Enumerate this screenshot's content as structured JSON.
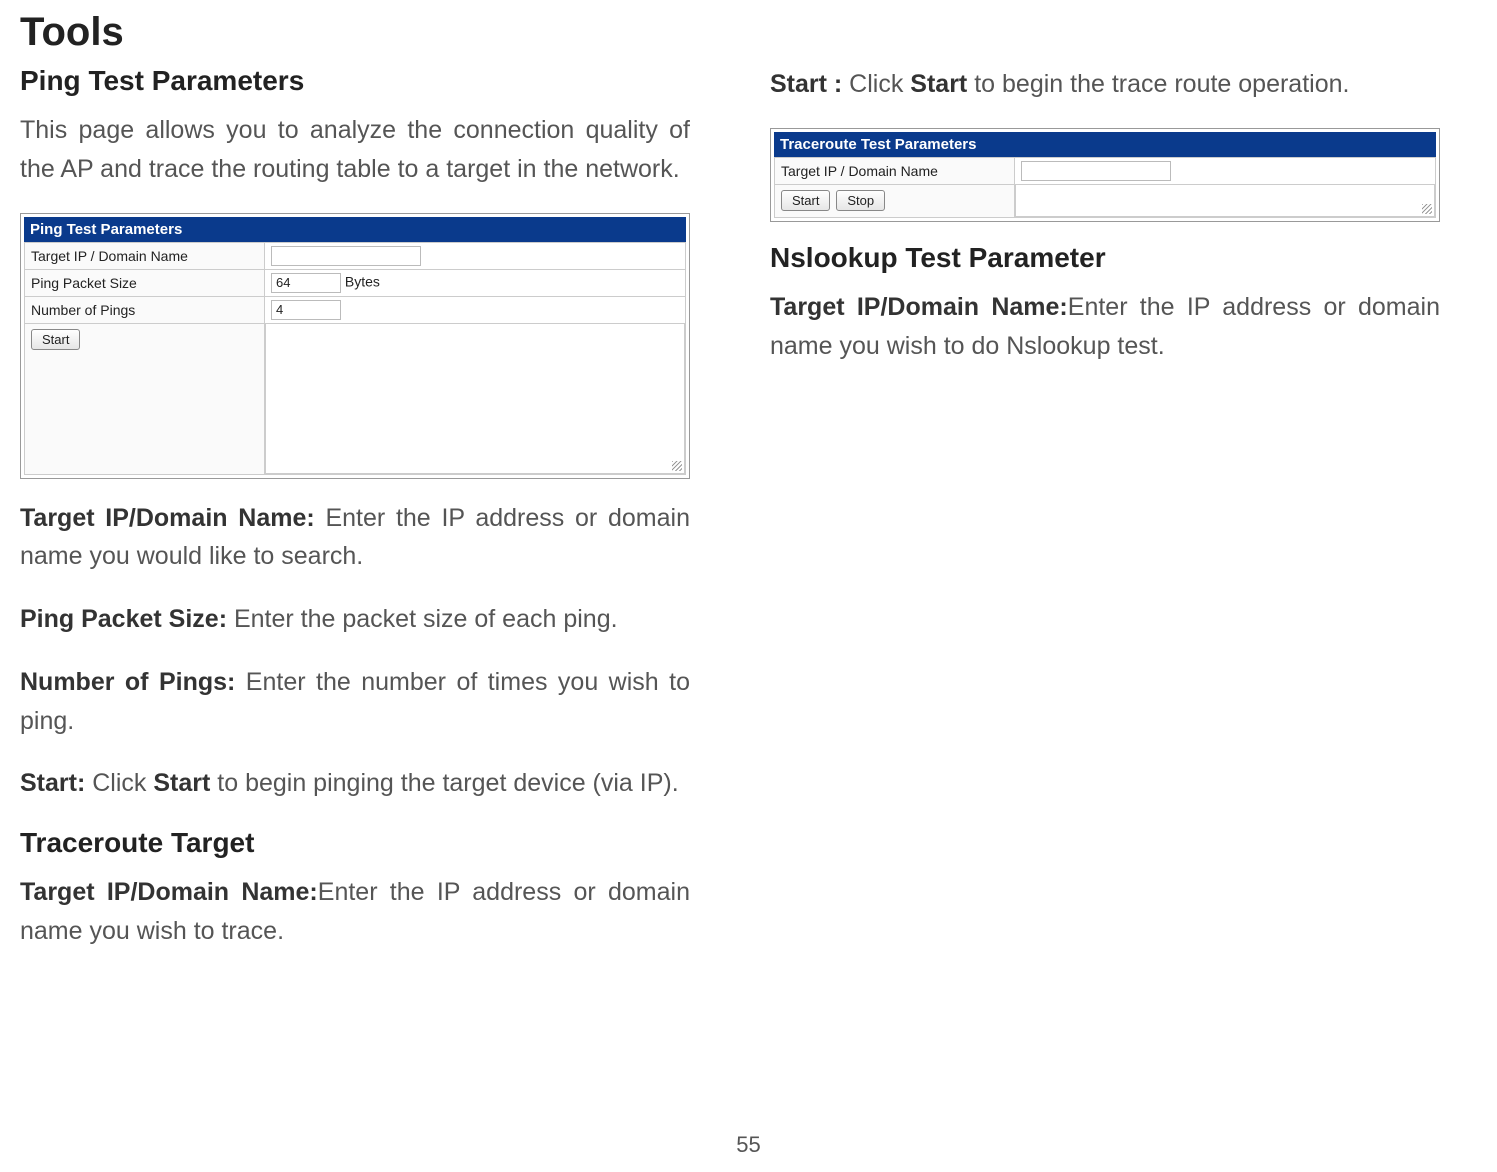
{
  "page_title": "Tools",
  "page_number": "55",
  "left": {
    "ping_section_title": "Ping Test Parameters",
    "intro": "This page allows you to analyze the connection quality of the AP and trace the routing table to a target in the network.",
    "ping_ui": {
      "header": "Ping Test Parameters",
      "row1_label": "Target IP / Domain Name",
      "row2_label": "Ping Packet Size",
      "row2_value": "64",
      "row2_unit": "Bytes",
      "row3_label": "Number of Pings",
      "row3_value": "4",
      "start_btn": "Start"
    },
    "target_label": "Target IP/Domain Name:",
    "target_text": " Enter the IP address or domain name you would like to search.",
    "pps_label": "Ping Packet Size:",
    "pps_text": " Enter the packet size of each ping.",
    "nop_label": "Number of Pings:",
    "nop_text": " Enter the number of times you wish to ping.",
    "start_label": "Start:",
    "start_text_pre": " Click ",
    "start_text_bold": "Start",
    "start_text_post": " to begin pinging the target device (via IP).",
    "trace_section_title": "Traceroute Target",
    "trace_target_label": "Target IP/Domain Name:",
    "trace_target_text": "Enter the IP address or domain name you wish to trace."
  },
  "right": {
    "start_label": "Start :",
    "start_pre": " Click ",
    "start_bold": "Start",
    "start_post": " to begin the trace route operation.",
    "trace_ui": {
      "header": "Traceroute Test Parameters",
      "row1_label": "Target IP / Domain Name",
      "start_btn": "Start",
      "stop_btn": "Stop"
    },
    "ns_section_title": "Nslookup Test Parameter",
    "ns_target_label": "Target IP/Domain Name:",
    "ns_target_text": "Enter the IP address or domain name you wish to do Nslookup test."
  }
}
